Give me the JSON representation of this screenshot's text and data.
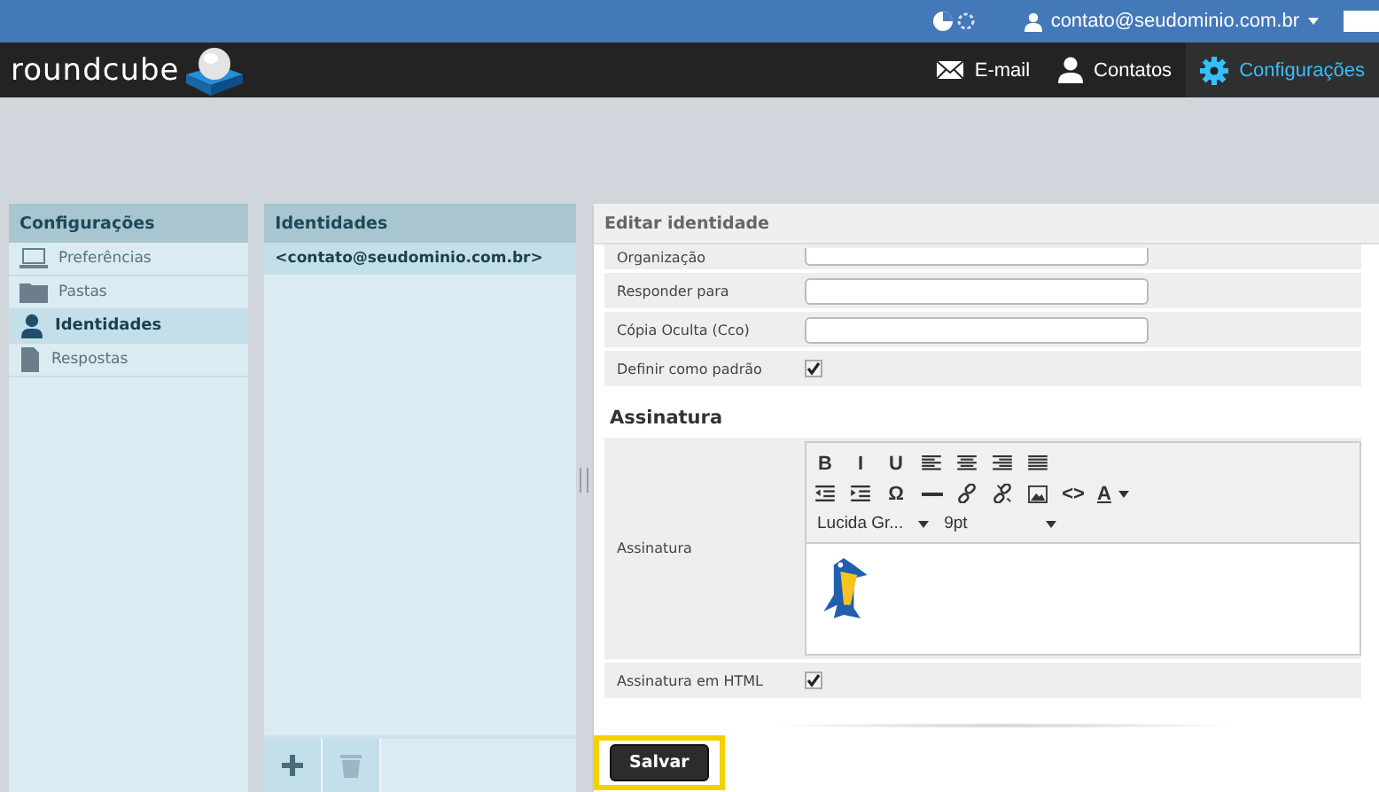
{
  "topbar": {
    "user": "contato@seudominio.com.br"
  },
  "logo": {
    "text": "roundcube"
  },
  "nav": [
    {
      "label": "E-mail",
      "kind": "mail",
      "selected": false
    },
    {
      "label": "Contatos",
      "kind": "person",
      "selected": false
    },
    {
      "label": "Configurações",
      "kind": "gear",
      "selected": true
    }
  ],
  "settings": {
    "title": "Configurações",
    "items": [
      {
        "label": "Preferências",
        "kind": "laptop",
        "selected": false
      },
      {
        "label": "Pastas",
        "kind": "folder",
        "selected": false
      },
      {
        "label": "Identidades",
        "kind": "person",
        "selected": true
      },
      {
        "label": "Respostas",
        "kind": "doc",
        "selected": false
      }
    ]
  },
  "identities": {
    "title": "Identidades",
    "items": [
      {
        "label": "<contato@seudominio.com.br>",
        "selected": true
      }
    ]
  },
  "editor": {
    "title": "Editar identidade",
    "fields": [
      {
        "label": "Organização",
        "kind": "text"
      },
      {
        "label": "Responder para",
        "kind": "text"
      },
      {
        "label": "Cópia Oculta (Cco)",
        "kind": "text"
      },
      {
        "label": "Definir como padrão",
        "kind": "checkbox",
        "checked": true
      }
    ],
    "section": "Assinatura",
    "signature_label": "Assinatura",
    "toolbar": [
      [
        {
          "kind": "text",
          "label": "B"
        },
        {
          "kind": "text",
          "label": "I"
        },
        {
          "kind": "text",
          "label": "U"
        },
        {
          "kind": "align-left"
        },
        {
          "kind": "align-center"
        },
        {
          "kind": "align-right"
        },
        {
          "kind": "justify"
        }
      ],
      [
        {
          "kind": "outdent"
        },
        {
          "kind": "indent"
        },
        {
          "kind": "text",
          "label": "Ω"
        },
        {
          "kind": "rule"
        },
        {
          "kind": "link"
        },
        {
          "kind": "unlink"
        },
        {
          "kind": "image"
        },
        {
          "kind": "text",
          "label": "<>"
        },
        {
          "kind": "color",
          "label": "A"
        }
      ]
    ],
    "font": "Lucida Gr...",
    "size": "9pt",
    "html": {
      "label": "Assinatura em HTML",
      "checked": true
    },
    "save": "Salvar"
  }
}
